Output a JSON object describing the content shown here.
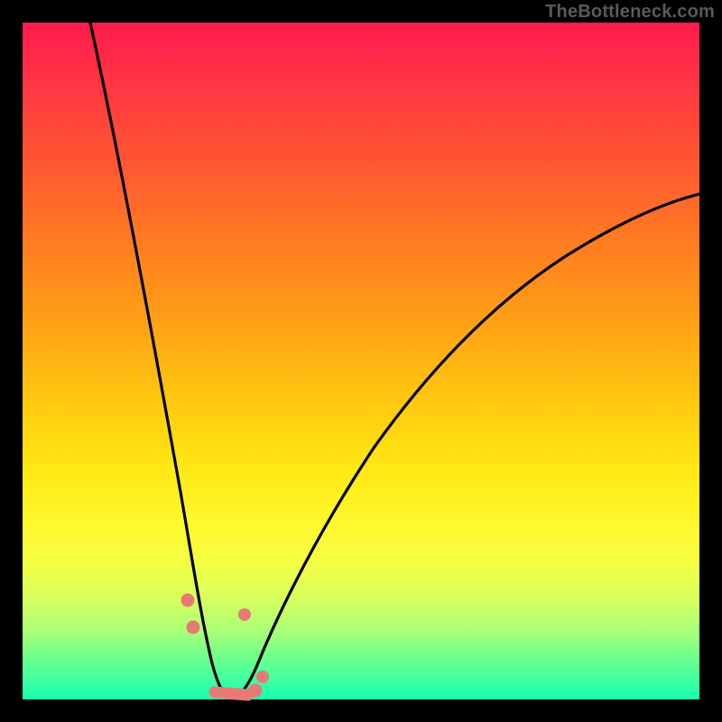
{
  "watermark": "TheBottleneck.com",
  "colors": {
    "curve": "#000000",
    "markers": "#e77a74",
    "frame": "#000000"
  },
  "chart_data": {
    "type": "line",
    "title": "",
    "xlabel": "",
    "ylabel": "",
    "xlim": [
      0,
      100
    ],
    "ylim": [
      0,
      100
    ],
    "grid": false,
    "legend": false,
    "curve_note": "Single V-shaped curve; y is bottleneck magnitude vs. component index; values estimated from pixel position since no axis labels are shown.",
    "x": [
      10,
      12.5,
      15,
      17.5,
      20,
      22.5,
      24,
      25.5,
      26.8,
      28,
      29,
      30,
      31,
      32,
      34,
      36,
      40,
      45,
      50,
      55,
      60,
      65,
      70,
      75,
      80,
      85,
      90,
      95,
      100
    ],
    "y": [
      100,
      89,
      78,
      67,
      56,
      44,
      34,
      24,
      15,
      8,
      3,
      0.5,
      0,
      0.5,
      2,
      4.5,
      11,
      19,
      27,
      34,
      40,
      46,
      51.5,
      56.5,
      61,
      65,
      68.5,
      71.5,
      74
    ],
    "markers": {
      "note": "Highlighted points near the curve minimum (pink dots).",
      "x": [
        24,
        25,
        28.5,
        30,
        31.5,
        33,
        34,
        35
      ],
      "y": [
        14,
        10,
        1,
        0.5,
        0.5,
        1,
        3,
        7
      ]
    }
  }
}
